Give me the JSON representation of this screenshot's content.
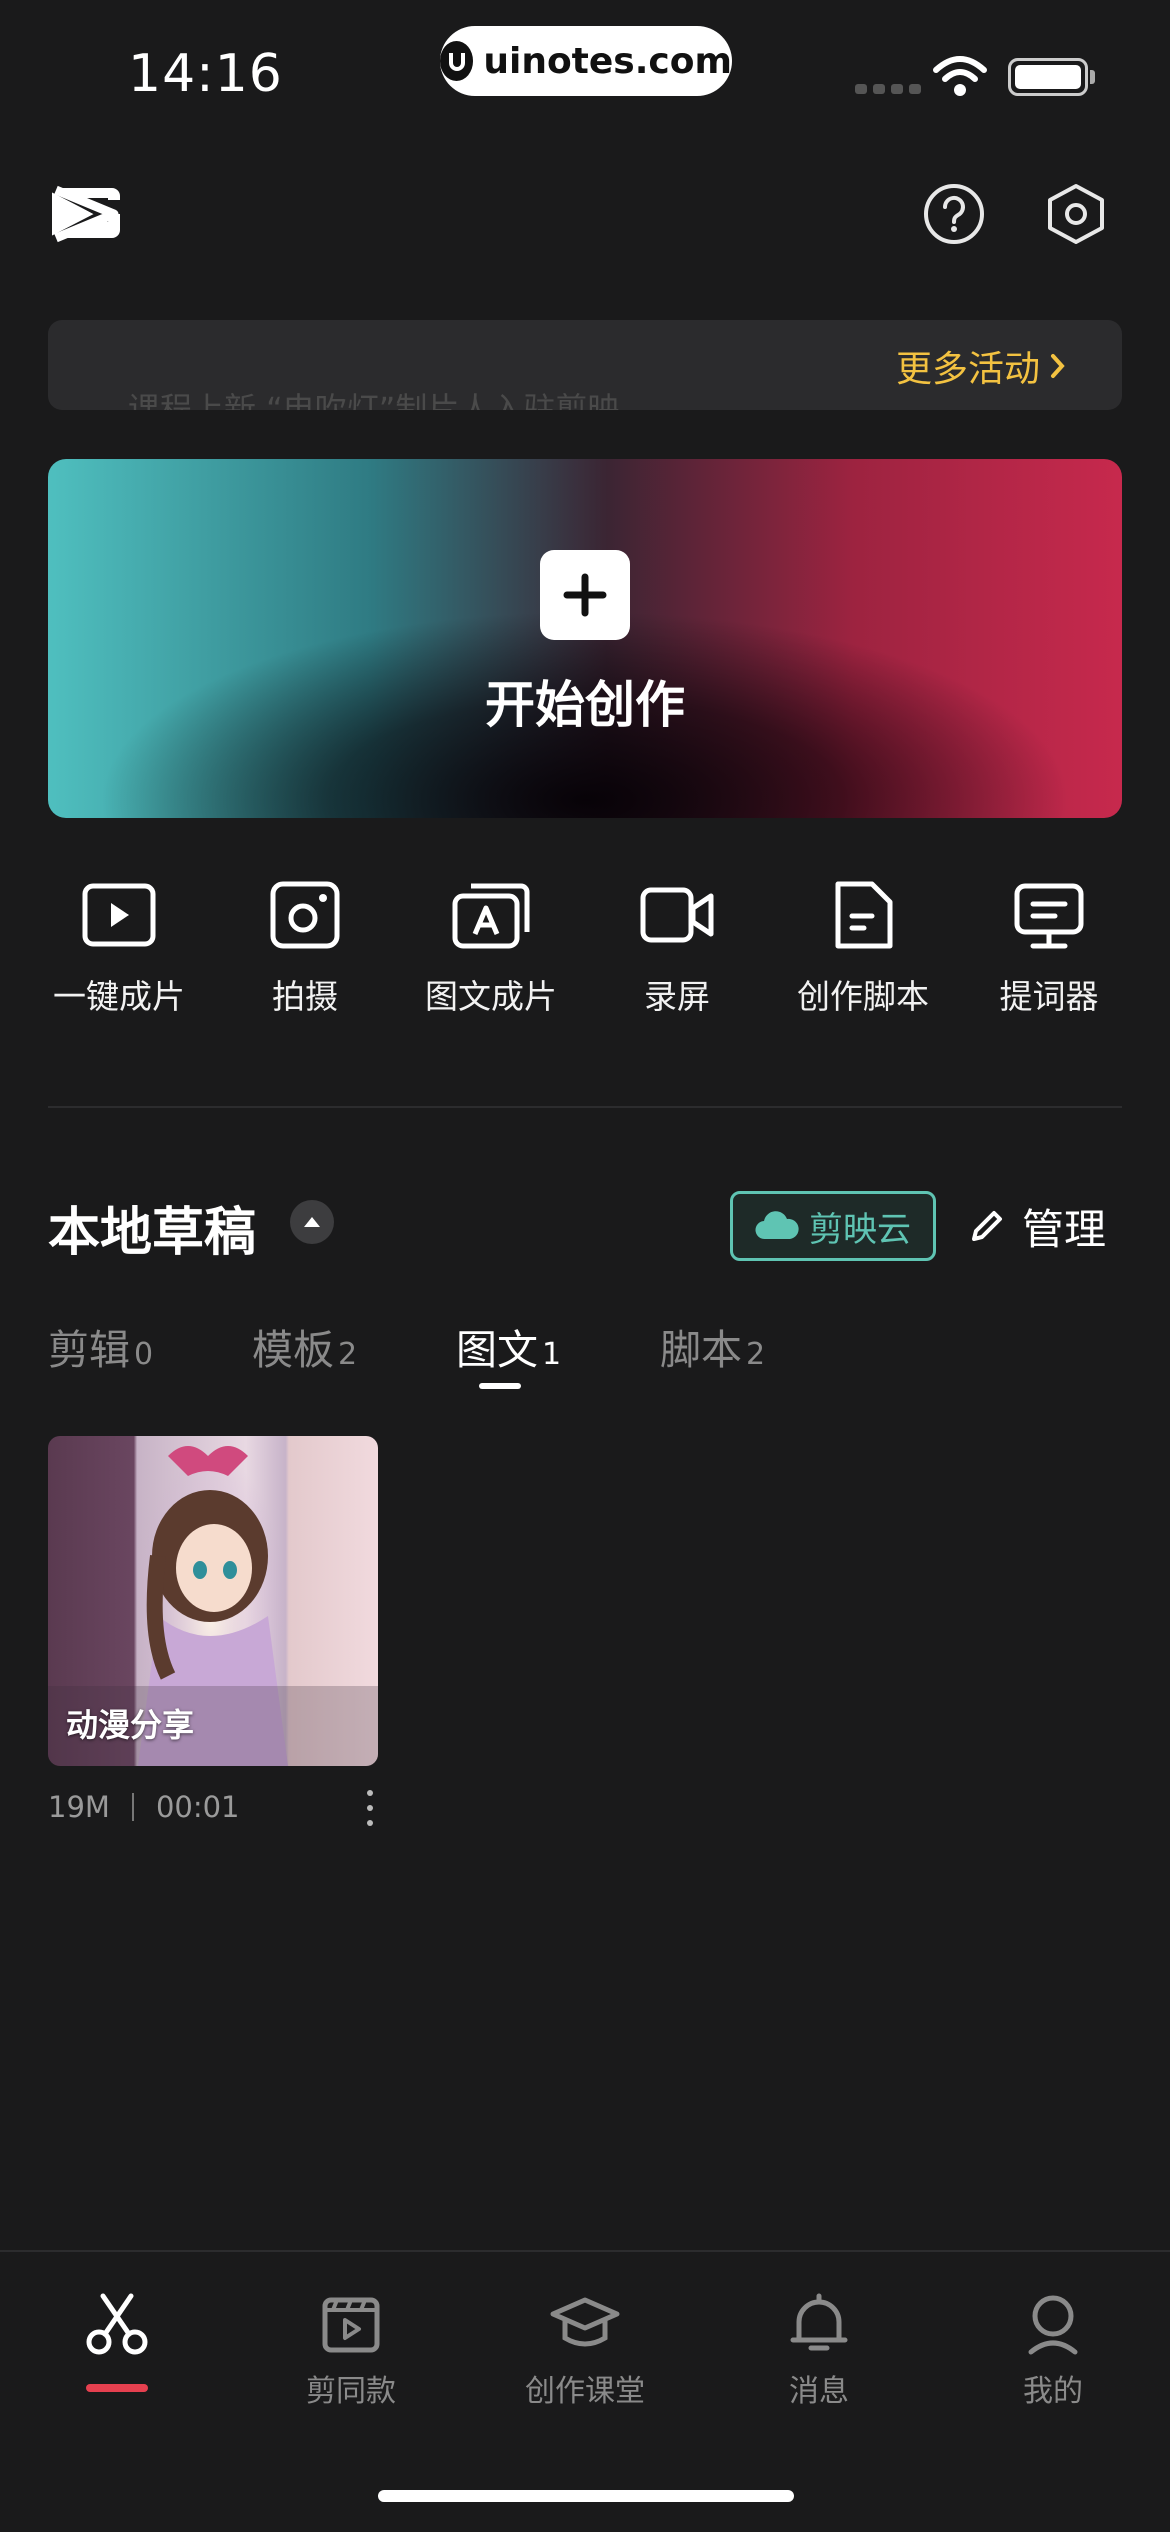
{
  "status_bar": {
    "time": "14:16",
    "watermark": "uinotes.com"
  },
  "header": {
    "logo_icon": "capcut-logo-icon",
    "help_icon": "help-icon",
    "settings_icon": "settings-icon"
  },
  "banner": {
    "ghost_text": "课程上新 “电吹灯”制片人入驻剪映",
    "more_label": "更多活动"
  },
  "hero": {
    "title": "开始创作"
  },
  "tools": [
    {
      "label": "一键成片",
      "icon": "play-square-icon"
    },
    {
      "label": "拍摄",
      "icon": "camera-icon"
    },
    {
      "label": "图文成片",
      "icon": "text-image-icon"
    },
    {
      "label": "录屏",
      "icon": "video-camera-icon"
    },
    {
      "label": "创作脚本",
      "icon": "document-icon"
    },
    {
      "label": "提词器",
      "icon": "teleprompter-icon"
    }
  ],
  "drafts": {
    "title": "本地草稿",
    "cloud_label": "剪映云",
    "manage_label": "管理",
    "tabs": [
      {
        "label": "剪辑",
        "count": "0",
        "active": false
      },
      {
        "label": "模板",
        "count": "2",
        "active": false
      },
      {
        "label": "图文",
        "count": "1",
        "active": true
      },
      {
        "label": "脚本",
        "count": "2",
        "active": false
      }
    ],
    "items": [
      {
        "name": "动漫分享",
        "size": "19M",
        "duration": "00:01"
      }
    ]
  },
  "bottom_nav": [
    {
      "label": "",
      "icon": "scissors-icon",
      "active": true
    },
    {
      "label": "剪同款",
      "icon": "template-icon",
      "active": false
    },
    {
      "label": "创作课堂",
      "icon": "graduation-cap-icon",
      "active": false
    },
    {
      "label": "消息",
      "icon": "bell-icon",
      "active": false
    },
    {
      "label": "我的",
      "icon": "profile-icon",
      "active": false
    }
  ],
  "colors": {
    "accent_yellow": "#f3c241",
    "cloud_teal": "#5fc4b3",
    "nav_active": "#e6404f"
  }
}
